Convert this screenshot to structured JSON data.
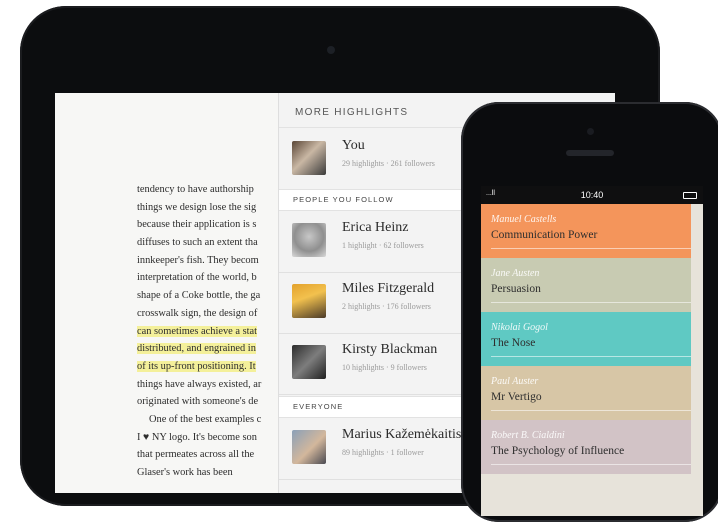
{
  "book_text": {
    "lines": [
      "tendency to have authorship",
      "things we design lose the sig",
      "because their application is s",
      "diffuses to such an extent tha",
      "innkeeper's fish. They becom",
      "interpretation of the world, b",
      "shape of a Coke bottle, the ga",
      "crosswalk sign, the design of",
      "can sometimes achieve a stat",
      "distributed, and engrained in",
      "of its up-front positioning. It",
      "things have always existed, ar",
      "originated with someone's de",
      "One of the best examples c",
      "I ♥ NY logo. It's become son",
      "that permeates across all the",
      "Glaser's work has been"
    ]
  },
  "highlights_panel": {
    "title": "MORE HIGHLIGHTS",
    "you": {
      "name": "You",
      "meta": "29 highlights · 261 followers"
    },
    "section_follow": "PEOPLE YOU FOLLOW",
    "following": [
      {
        "name": "Erica Heinz",
        "meta": "1 highlight · 62 followers"
      },
      {
        "name": "Miles Fitzgerald",
        "meta": "2 highlights · 176 followers"
      },
      {
        "name": "Kirsty Blackman",
        "meta": "10 highlights · 9 followers"
      }
    ],
    "section_everyone": "EVERYONE",
    "everyone": [
      {
        "name": "Marius Kažemėkaitis",
        "meta": "89 highlights · 1 follower"
      }
    ]
  },
  "phone": {
    "time": "10:40",
    "signal": "...ll",
    "books": [
      {
        "author": "Manuel Castells",
        "title": "Communication Power",
        "color": "#f4955b"
      },
      {
        "author": "Jane Austen",
        "title": "Persuasion",
        "color": "#c8cbb2"
      },
      {
        "author": "Nikolai Gogol",
        "title": "The Nose",
        "color": "#5fc9c3"
      },
      {
        "author": "Paul Auster",
        "title": "Mr Vertigo",
        "color": "#d7c6a6"
      },
      {
        "author": "Robert B. Cialdini",
        "title": "The Psychology of Influence",
        "color": "#d2c3c6"
      }
    ]
  }
}
